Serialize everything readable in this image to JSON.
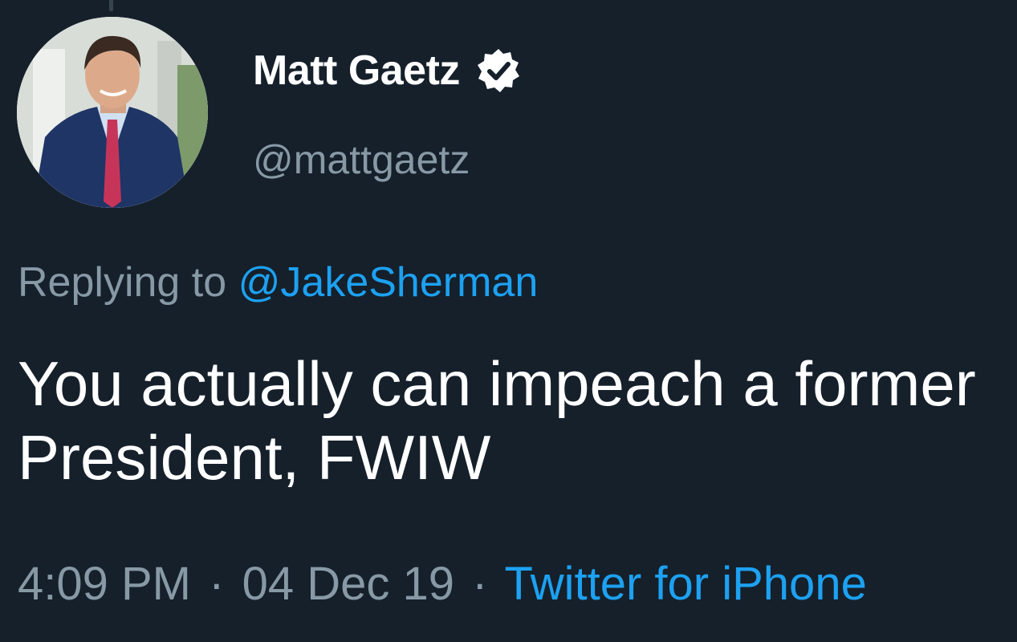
{
  "tweet": {
    "author": {
      "display_name": "Matt Gaetz",
      "handle": "@mattgaetz",
      "verified_icon": "verified-badge-icon"
    },
    "reply_prefix": "Replying to",
    "reply_to": "@JakeSherman",
    "text": "You actually can impeach a former President, FWIW",
    "time": "4:09 PM",
    "date": "04 Dec 19",
    "separator": "·",
    "source": "Twitter for iPhone"
  },
  "colors": {
    "background": "#15202b",
    "primary_text": "#ffffff",
    "secondary_text": "#8899a6",
    "accent": "#1da1f2"
  }
}
